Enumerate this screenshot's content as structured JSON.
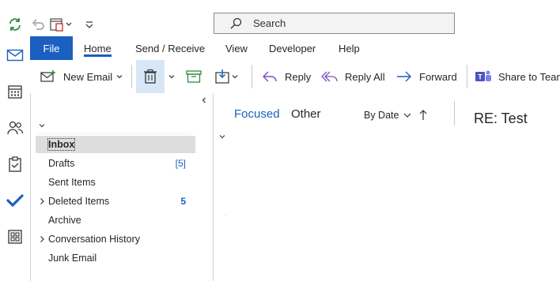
{
  "quick_access": {
    "sync": "sync-icon",
    "undo": "undo-icon",
    "delete_all": "delete-all-icon",
    "customize": "customize-qat-icon"
  },
  "search": {
    "placeholder": "Search"
  },
  "app_bar": {
    "items": [
      {
        "name": "mail-icon",
        "active": true
      },
      {
        "name": "calendar-icon"
      },
      {
        "name": "people-icon"
      },
      {
        "name": "tasks-icon"
      },
      {
        "name": "todo-icon"
      },
      {
        "name": "apps-icon"
      }
    ]
  },
  "tabs": {
    "file": "File",
    "home": "Home",
    "send_receive": "Send / Receive",
    "view": "View",
    "developer": "Developer",
    "help": "Help"
  },
  "ribbon": {
    "new_email": "New Email",
    "reply": "Reply",
    "reply_all": "Reply All",
    "forward": "Forward",
    "share_to_teams": "Share to Teams"
  },
  "folders": {
    "items": [
      {
        "label": "Inbox",
        "count": "",
        "selected": true,
        "expandable": false
      },
      {
        "label": "Drafts",
        "count": "[5]",
        "expandable": false
      },
      {
        "label": "Sent Items",
        "count": "",
        "expandable": false
      },
      {
        "label": "Deleted Items",
        "count": "5",
        "bold_count": true,
        "expandable": true
      },
      {
        "label": "Archive",
        "count": "",
        "expandable": false
      },
      {
        "label": "Conversation History",
        "count": "",
        "expandable": true
      },
      {
        "label": "Junk Email",
        "count": "",
        "expandable": false
      }
    ]
  },
  "message_list": {
    "focused": "Focused",
    "other": "Other",
    "sort": "By Date"
  },
  "reading_pane": {
    "subject": "RE: Test"
  },
  "colors": {
    "accent": "#1b5fc0",
    "selected_row": "#dddddd"
  }
}
